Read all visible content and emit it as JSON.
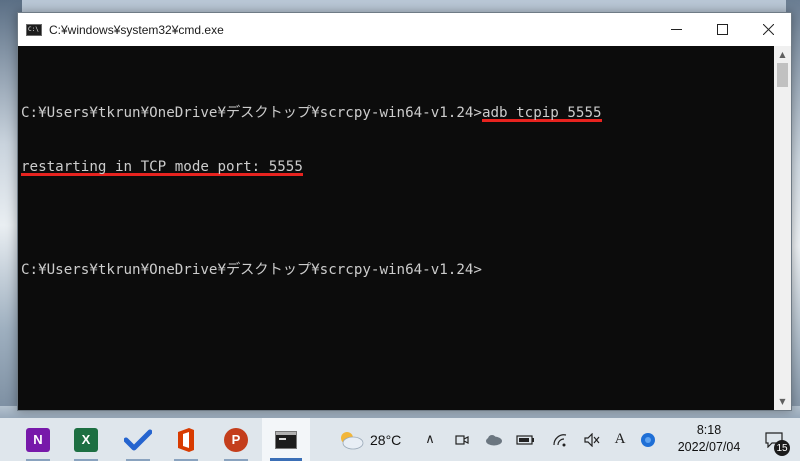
{
  "window": {
    "title": "C:¥windows¥system32¥cmd.exe",
    "controls": {
      "minimize": "—",
      "maximize": "☐",
      "close": "✕"
    }
  },
  "console": {
    "line1_prompt": "C:¥Users¥tkrun¥OneDrive¥デスクトップ¥scrcpy-win64-v1.24>",
    "line1_command": "adb tcpip 5555",
    "line2_output": "restarting in TCP mode port: 5555",
    "line3_prompt": "C:¥Users¥tkrun¥OneDrive¥デスクトップ¥scrcpy-win64-v1.24>",
    "highlight_color": "#e8231f"
  },
  "taskbar": {
    "apps": [
      {
        "name": "onenote",
        "letter": "N",
        "color": "#7719aa"
      },
      {
        "name": "excel",
        "letter": "X",
        "color": "#1d6f42"
      },
      {
        "name": "todo",
        "letter": "",
        "color": "#2564cf"
      },
      {
        "name": "office",
        "letter": "",
        "color": "#d83b01"
      },
      {
        "name": "powerpoint",
        "letter": "P",
        "color": "#c43e1c"
      },
      {
        "name": "cmd",
        "letter": "",
        "color": "#1c1c1c"
      }
    ],
    "weather": {
      "temp": "28°C",
      "icon": "partly-cloudy-icon"
    },
    "tray": {
      "chevron": "∧",
      "ime": "A"
    },
    "clock": {
      "time": "8:18",
      "date": "2022/07/04"
    },
    "notifications": {
      "count": "15"
    }
  }
}
